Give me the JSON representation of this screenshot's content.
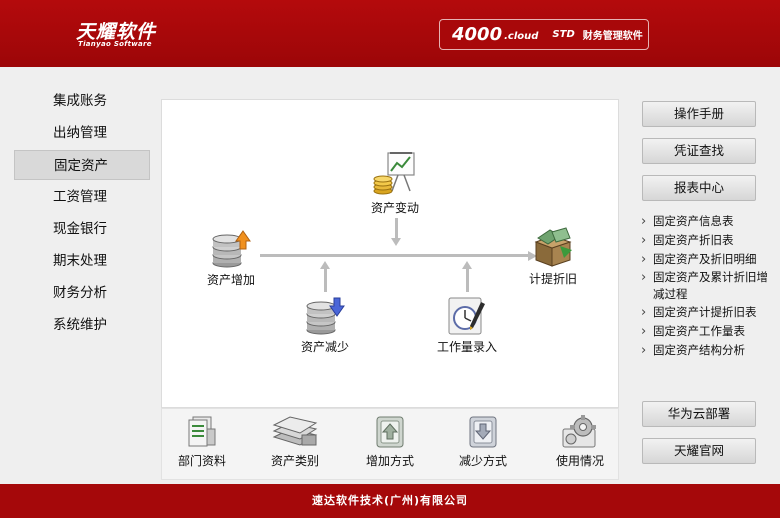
{
  "header": {
    "logo_main": "天耀软件",
    "logo_sub": "Tianyao Software",
    "product_num": "4000",
    "product_cloud": ".cloud",
    "product_std": "STD",
    "product_desc": "财务管理软件"
  },
  "nav": {
    "items": [
      {
        "label": "集成账务"
      },
      {
        "label": "出纳管理"
      },
      {
        "label": "固定资产"
      },
      {
        "label": "工资管理"
      },
      {
        "label": "现金银行"
      },
      {
        "label": "期末处理"
      },
      {
        "label": "财务分析"
      },
      {
        "label": "系统维护"
      }
    ],
    "active_index": 2
  },
  "flow": {
    "asset_change": "资产变动",
    "asset_add": "资产增加",
    "depreciation": "计提折旧",
    "asset_reduce": "资产减少",
    "workload": "工作量录入"
  },
  "bottom_bar": [
    {
      "label": "部门资料",
      "icon": "department-docs-icon"
    },
    {
      "label": "资产类别",
      "icon": "asset-category-icon"
    },
    {
      "label": "增加方式",
      "icon": "add-method-icon"
    },
    {
      "label": "减少方式",
      "icon": "reduce-method-icon"
    },
    {
      "label": "使用情况",
      "icon": "usage-gear-icon"
    }
  ],
  "right": {
    "manual_button": "操作手册",
    "voucher_button": "凭证查找",
    "report_button": "报表中心",
    "reports": [
      "固定资产信息表",
      "固定资产折旧表",
      "固定资产及折旧明细",
      "固定资产及累计折旧增减过程",
      "固定资产计提折旧表",
      "固定资产工作量表",
      "固定资产结构分析"
    ],
    "huawei_button": "华为云部署",
    "official_button": "天耀官网"
  },
  "footer": {
    "text": "速达软件技术(广州)有限公司"
  },
  "colors": {
    "brand_red": "#a5080a",
    "panel_bg": "#efefef"
  }
}
